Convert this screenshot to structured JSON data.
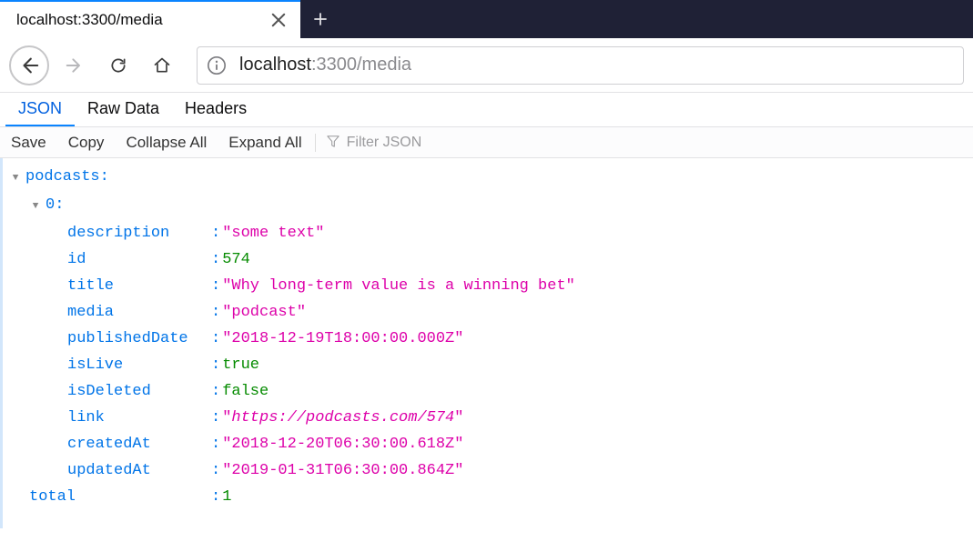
{
  "browser": {
    "tab_title": "localhost:3300/media",
    "url_host": "localhost",
    "url_port_path": ":3300/media",
    "newtab_tooltip": "Open a new tab"
  },
  "view_tabs": {
    "json": "JSON",
    "raw": "Raw Data",
    "headers": "Headers"
  },
  "toolbar": {
    "save": "Save",
    "copy": "Copy",
    "collapse": "Collapse All",
    "expand": "Expand All",
    "filter_placeholder": "Filter JSON"
  },
  "json": {
    "root_key": "podcasts",
    "index_key": "0",
    "fields": {
      "description": {
        "k": "description",
        "v": "\"some text\"",
        "type": "string"
      },
      "id": {
        "k": "id",
        "v": "574",
        "type": "number"
      },
      "title": {
        "k": "title",
        "v": "\"Why long-term value is a winning bet\"",
        "type": "string"
      },
      "media": {
        "k": "media",
        "v": "\"podcast\"",
        "type": "string"
      },
      "publishedDate": {
        "k": "publishedDate",
        "v": "\"2018-12-19T18:00:00.000Z\"",
        "type": "string"
      },
      "isLive": {
        "k": "isLive",
        "v": "true",
        "type": "bool"
      },
      "isDeleted": {
        "k": "isDeleted",
        "v": "false",
        "type": "bool"
      },
      "link": {
        "k": "link",
        "v": "https://podcasts.com/574",
        "type": "link"
      },
      "createdAt": {
        "k": "createdAt",
        "v": "\"2018-12-20T06:30:00.618Z\"",
        "type": "string"
      },
      "updatedAt": {
        "k": "updatedAt",
        "v": "\"2019-01-31T06:30:00.864Z\"",
        "type": "string"
      }
    },
    "total_key": "total",
    "total_value": "1"
  }
}
